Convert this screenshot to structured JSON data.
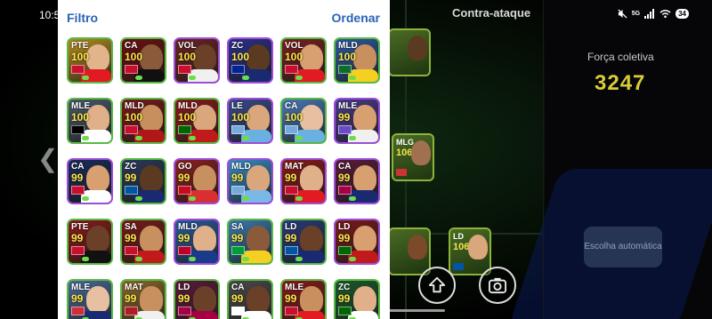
{
  "status_bar": {
    "time": "10:56",
    "network": "5G",
    "battery": "34"
  },
  "panel": {
    "filter_label": "Filtro",
    "sort_label": "Ordenar",
    "back_chevron": "❮"
  },
  "players": [
    {
      "pos": "PTE",
      "ovr": "100",
      "bg": "#b58d20",
      "border": "green",
      "flag": "#c8102e",
      "skin": "#e2b48c",
      "kit": "#e21b23"
    },
    {
      "pos": "CA",
      "ovr": "100",
      "bg": "#6b1010",
      "border": "green",
      "flag": "#c8102e",
      "skin": "#8a5a3a",
      "kit": "#101010"
    },
    {
      "pos": "VOL",
      "ovr": "100",
      "bg": "#6b2222",
      "border": "purple",
      "flag": "#c8102e",
      "skin": "#6b4028",
      "kit": "#f0f0f0"
    },
    {
      "pos": "ZC",
      "ovr": "100",
      "bg": "#2b2f8a",
      "border": "purple",
      "flag": "#002395",
      "skin": "#5b3a22",
      "kit": "#1a2a70"
    },
    {
      "pos": "VOL",
      "ovr": "100",
      "bg": "#7a1f1f",
      "border": "green",
      "flag": "#c8102e",
      "skin": "#d8a070",
      "kit": "#e21b23"
    },
    {
      "pos": "MLD",
      "ovr": "100",
      "bg": "#2c5aa0",
      "border": "green",
      "flag": "#0d6e2a",
      "skin": "#c8905e",
      "kit": "#f5d020"
    },
    {
      "pos": "MLE",
      "ovr": "100",
      "bg": "#4a5a6a",
      "border": "green",
      "flag": "#000000",
      "skin": "#e0b08a",
      "kit": "#ffffff"
    },
    {
      "pos": "MLD",
      "ovr": "100",
      "bg": "#7a1a1a",
      "border": "green",
      "flag": "#c8102e",
      "skin": "#c88f5e",
      "kit": "#b01818"
    },
    {
      "pos": "MLD",
      "ovr": "100",
      "bg": "#8a1a1a",
      "border": "green",
      "flag": "#006600",
      "skin": "#d9a77b",
      "kit": "#c01a1a"
    },
    {
      "pos": "LE",
      "ovr": "100",
      "bg": "#3a4a8a",
      "border": "purple",
      "flag": "#75aadb",
      "skin": "#d9a77b",
      "kit": "#6ab0e0"
    },
    {
      "pos": "CA",
      "ovr": "100",
      "bg": "#4a7ab8",
      "border": "green",
      "flag": "#75aadb",
      "skin": "#e6c0a0",
      "kit": "#6ab0e0"
    },
    {
      "pos": "MLE",
      "ovr": "99",
      "bg": "#4a3a8a",
      "border": "purple",
      "flag": "#6a4cc8",
      "skin": "#d8a070",
      "kit": "#f0f0f0"
    },
    {
      "pos": "CA",
      "ovr": "99",
      "bg": "#1a2a5a",
      "border": "purple",
      "flag": "#c8102e",
      "skin": "#d8a070",
      "kit": "#ffffff"
    },
    {
      "pos": "ZC",
      "ovr": "99",
      "bg": "#2a3a5a",
      "border": "green",
      "flag": "#0055a4",
      "skin": "#5b3a22",
      "kit": "#1a2a70"
    },
    {
      "pos": "GO",
      "ovr": "99",
      "bg": "#8a2020",
      "border": "purple",
      "flag": "#c60b1e",
      "skin": "#c8905e",
      "kit": "#d83030"
    },
    {
      "pos": "MLD",
      "ovr": "99",
      "bg": "#3a8ac8",
      "border": "purple",
      "flag": "#75aadb",
      "skin": "#d9a77b",
      "kit": "#7ab8e8"
    },
    {
      "pos": "MAT",
      "ovr": "99",
      "bg": "#8a1a1a",
      "border": "purple",
      "flag": "#c8102e",
      "skin": "#e0b08a",
      "kit": "#e21b23"
    },
    {
      "pos": "CA",
      "ovr": "99",
      "bg": "#5a1a3a",
      "border": "purple",
      "flag": "#a50044",
      "skin": "#d8a070",
      "kit": "#1a2a70"
    },
    {
      "pos": "PTE",
      "ovr": "99",
      "bg": "#8a1a1a",
      "border": "green",
      "flag": "#c8102e",
      "skin": "#6b4028",
      "kit": "#111111"
    },
    {
      "pos": "SA",
      "ovr": "99",
      "bg": "#7a1a1a",
      "border": "green",
      "flag": "#c8102e",
      "skin": "#c8905e",
      "kit": "#c01a1a"
    },
    {
      "pos": "MLD",
      "ovr": "99",
      "bg": "#2a5a9a",
      "border": "purple",
      "flag": "#bc002d",
      "skin": "#e0b08a",
      "kit": "#1a3a8a"
    },
    {
      "pos": "SA",
      "ovr": "99",
      "bg": "#3a7ab0",
      "border": "green",
      "flag": "#009c3b",
      "skin": "#8a5a3a",
      "kit": "#f5d020"
    },
    {
      "pos": "LD",
      "ovr": "99",
      "bg": "#2a3a7a",
      "border": "green",
      "flag": "#0055a4",
      "skin": "#6b4028",
      "kit": "#1a2a70"
    },
    {
      "pos": "LD",
      "ovr": "99",
      "bg": "#7a1a1a",
      "border": "purple",
      "flag": "#006600",
      "skin": "#d8a070",
      "kit": "#c01a1a"
    },
    {
      "pos": "MLE",
      "ovr": "99",
      "bg": "#4a6a9a",
      "border": "green",
      "flag": "#cd2e3a",
      "skin": "#e6c0a0",
      "kit": "#1a2a70"
    },
    {
      "pos": "MAT",
      "ovr": "99",
      "bg": "#8a6a2a",
      "border": "green",
      "flag": "#ae1c28",
      "skin": "#c8905e",
      "kit": "#f0f0f0"
    },
    {
      "pos": "LD",
      "ovr": "99",
      "bg": "#5a1a3a",
      "border": "green",
      "flag": "#a50044",
      "skin": "#6b4028",
      "kit": "#a50044"
    },
    {
      "pos": "CA",
      "ovr": "99",
      "bg": "#4a4a4a",
      "border": "green",
      "flag": "#ffffff",
      "skin": "#6b4028",
      "kit": "#ffffff"
    },
    {
      "pos": "MLE",
      "ovr": "99",
      "bg": "#8a1a1a",
      "border": "green",
      "flag": "#c8102e",
      "skin": "#c8905e",
      "kit": "#e21b23"
    },
    {
      "pos": "ZC",
      "ovr": "99",
      "bg": "#1a5a2a",
      "border": "green",
      "flag": "#006600",
      "skin": "#e0b08a",
      "kit": "#ffffff"
    }
  ],
  "formation": {
    "mode_title": "Contra-ataque",
    "team_strength_label": "Força coletiva",
    "team_strength_value": "3247",
    "auto_select_label": "Escolha automática",
    "field_cards": [
      {
        "pos": "MLG",
        "ovr": "106"
      },
      {
        "pos": "LD",
        "ovr": "106"
      }
    ]
  }
}
